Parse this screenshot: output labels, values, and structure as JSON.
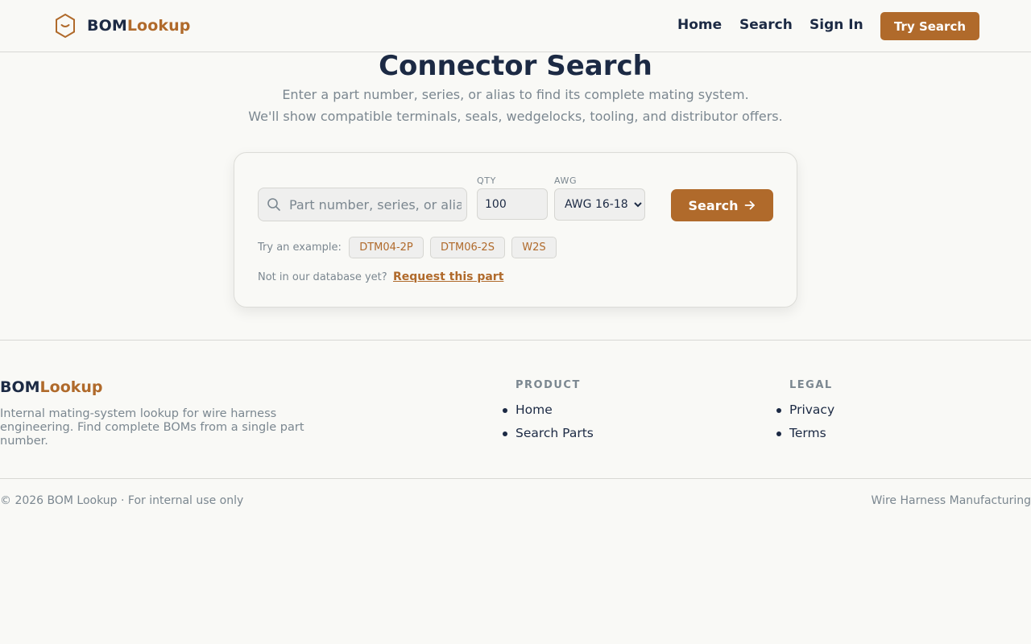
{
  "header": {
    "brand_primary": "BOM",
    "brand_accent": "Lookup",
    "nav": [
      "Home",
      "Search",
      "Sign In"
    ],
    "cta_label": "Try Search"
  },
  "hero": {
    "title": "Connector Search",
    "subtitle_1": "Enter a part number, series, or alias to find its complete mating system.",
    "subtitle_2": "We'll show compatible terminals, seals, wedgelocks, tooling, and distributor offers."
  },
  "search": {
    "placeholder": "Part number, series, or alias",
    "value": "",
    "qty_label": "QTY",
    "qty_value": "100",
    "awg_label": "AWG",
    "awg_selected": "AWG 16-18",
    "button_label": "Search",
    "examples_label": "Try an example:",
    "examples": [
      "DTM04-2P",
      "DTM06-2S",
      "W2S"
    ],
    "request_text": "Not in our database yet?",
    "request_link": "Request this part"
  },
  "footer": {
    "brand_primary": "BOM",
    "brand_accent": "Lookup",
    "description": "Internal mating-system lookup for wire harness engineering. Find complete BOMs from a single part number.",
    "product_heading": "PRODUCT",
    "product_links": [
      "Home",
      "Search Parts"
    ],
    "legal_heading": "LEGAL",
    "legal_links": [
      "Privacy",
      "Terms"
    ],
    "copyright": "© 2026 BOM Lookup · For internal use only",
    "tagline": "Wire Harness Manufacturing"
  },
  "icons": {
    "logo": "hexagon-logo-icon",
    "search": "search-icon",
    "arrow": "arrow-right-icon"
  },
  "colors": {
    "accent": "#b06a2b",
    "navy": "#1c2a44",
    "muted": "#7b8790",
    "background": "#f9f9f6"
  }
}
